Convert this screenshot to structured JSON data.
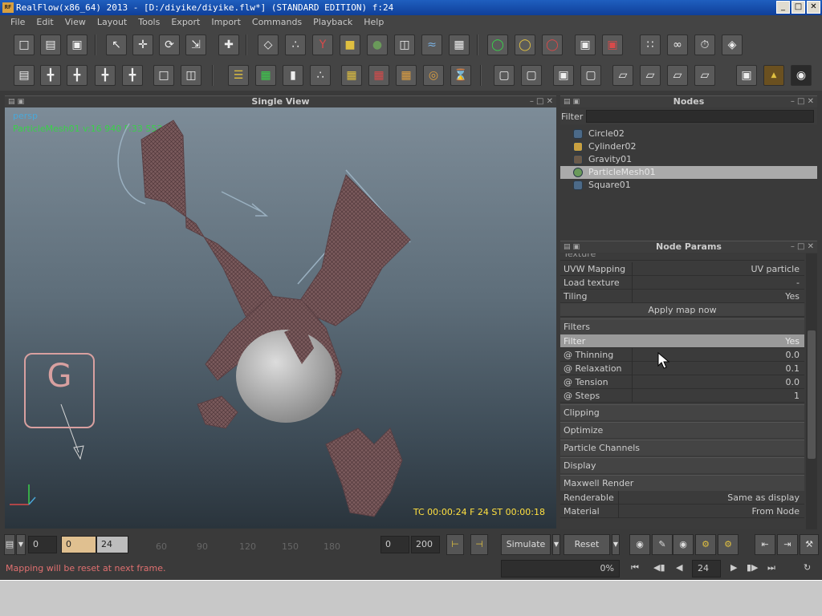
{
  "window": {
    "title": "RealFlow(x86_64) 2013 - [D:/diyike/diyike.flw*] (STANDARD EDITION) f:24",
    "app_icon": "RF",
    "buttons": [
      "_",
      "□",
      "✕"
    ]
  },
  "menu": [
    "File",
    "Edit",
    "View",
    "Layout",
    "Tools",
    "Export",
    "Import",
    "Commands",
    "Playback",
    "Help"
  ],
  "viewport": {
    "title": "Single View",
    "camera": "persp",
    "info": "ParticleMesh01 v:16 940 F:33 553",
    "status": "TC 00:00:24    F 24    ST 00:00:18",
    "gravity_letter": "G"
  },
  "nodes_panel": {
    "title": "Nodes",
    "filter_label": "Filter",
    "items": [
      {
        "label": "Circle02",
        "icon": "emitter-icon",
        "selected": false
      },
      {
        "label": "Cylinder02",
        "icon": "object-icon",
        "selected": false
      },
      {
        "label": "Gravity01",
        "icon": "daemon-icon",
        "selected": false
      },
      {
        "label": "ParticleMesh01",
        "icon": "mesh-icon",
        "selected": true
      },
      {
        "label": "Square01",
        "icon": "emitter-icon",
        "selected": false
      }
    ]
  },
  "params_panel": {
    "title": "Node Params",
    "top_partial": "Texture",
    "rows_top": [
      {
        "label": "UVW Mapping",
        "value": "UV particle"
      },
      {
        "label": "Load texture",
        "value": "-"
      },
      {
        "label": "Tiling",
        "value": "Yes"
      }
    ],
    "apply_button": "Apply map now",
    "filters_section": "Filters",
    "filter_rows": [
      {
        "label": "Filter",
        "value": "Yes"
      },
      {
        "label": "@ Thinning",
        "value": "0.0"
      },
      {
        "label": "@ Relaxation",
        "value": "0.1"
      },
      {
        "label": "@ Tension",
        "value": "0.0"
      },
      {
        "label": "@ Steps",
        "value": "1"
      }
    ],
    "sections": [
      "Clipping",
      "Optimize",
      "Particle Channels",
      "Display",
      "Maxwell Render"
    ],
    "rows_bottom": [
      {
        "label": "Renderable",
        "value": "Same as display"
      },
      {
        "label": "Material",
        "value": "From Node"
      }
    ]
  },
  "timeline": {
    "start": "0",
    "current": "24",
    "marker": "0",
    "ticks": [
      "60",
      "90",
      "120",
      "150",
      "180"
    ],
    "range_start": "0",
    "range_end": "200",
    "simulate": "Simulate",
    "reset": "Reset"
  },
  "playback": {
    "progress": "0%",
    "frame": "24"
  },
  "status": {
    "message": "Mapping will be reset at next frame."
  },
  "colors": {
    "accent_green": "#3ad04a",
    "accent_blue": "#4aa8d8",
    "status_yellow": "#ffe040",
    "status_red": "#d84a4a"
  }
}
